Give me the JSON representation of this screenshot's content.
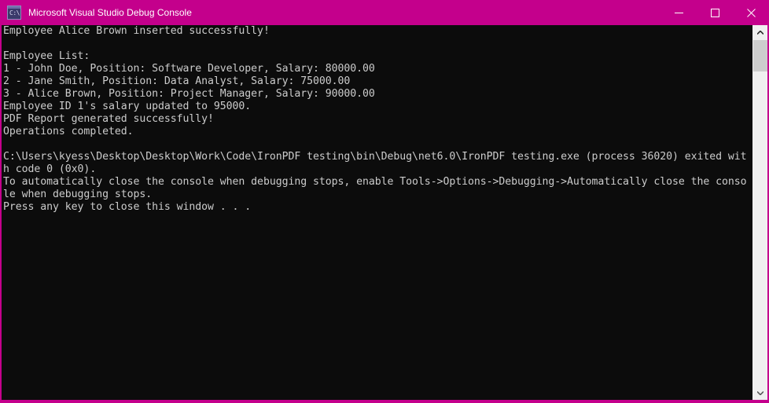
{
  "window": {
    "title": "Microsoft Visual Studio Debug Console",
    "icon_name": "console-app-icon",
    "icon_glyph": "C:\\",
    "titlebar_color": "#C4008C",
    "console_background": "#0C0C0C",
    "console_foreground": "#CCCCCC"
  },
  "caption_buttons": {
    "minimize_label": "Minimize",
    "maximize_label": "Maximize",
    "close_label": "Close"
  },
  "console": {
    "lines": [
      "Employee Alice Brown inserted successfully!",
      "",
      "Employee List:",
      "1 - John Doe, Position: Software Developer, Salary: 80000.00",
      "2 - Jane Smith, Position: Data Analyst, Salary: 75000.00",
      "3 - Alice Brown, Position: Project Manager, Salary: 90000.00",
      "Employee ID 1's salary updated to 95000.",
      "PDF Report generated successfully!",
      "Operations completed.",
      "",
      "C:\\Users\\kyess\\Desktop\\Desktop\\Work\\Code\\IronPDF testing\\bin\\Debug\\net6.0\\IronPDF testing.exe (process 36020) exited wit",
      "h code 0 (0x0).",
      "To automatically close the console when debugging stops, enable Tools->Options->Debugging->Automatically close the conso",
      "le when debugging stops.",
      "Press any key to close this window . . ."
    ]
  },
  "scrollbar": {
    "up_arrow_label": "Scroll up",
    "down_arrow_label": "Scroll down",
    "thumb_label": "Scroll thumb"
  }
}
